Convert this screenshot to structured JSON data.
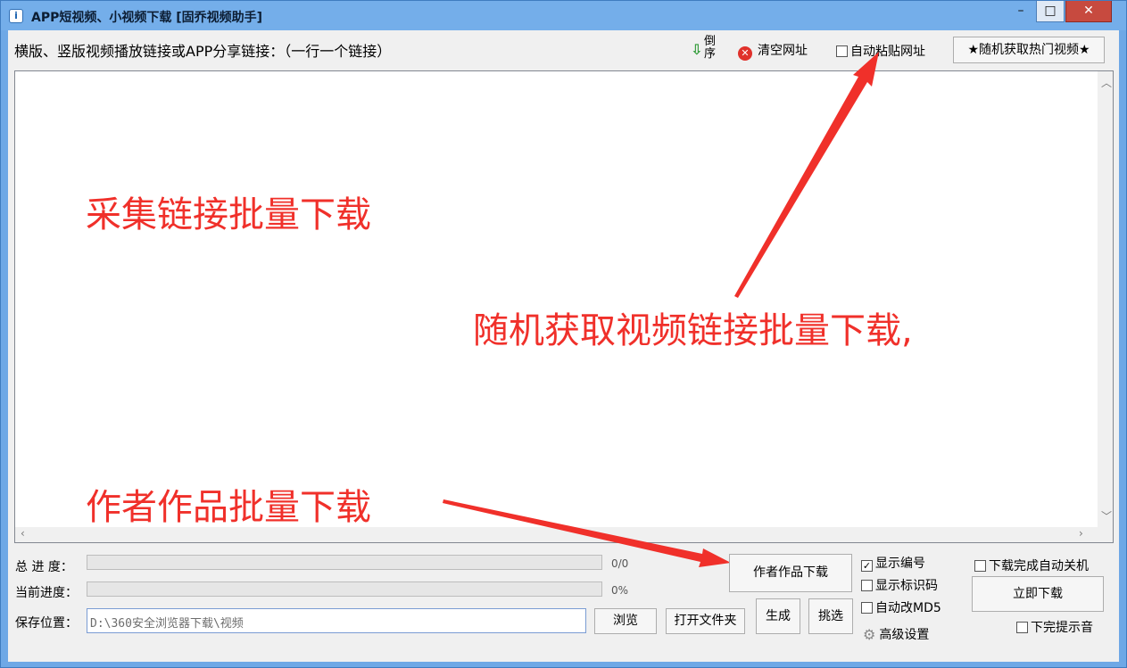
{
  "window": {
    "title": "APP短视频、小视频下载 [固乔视频助手]",
    "min_glyph": "–",
    "max_glyph": "□",
    "close_glyph": "✕"
  },
  "toolbar": {
    "link_label": "横版、竖版视频播放链接或APP分享链接：（一行一个链接）",
    "sort_label": "倒序",
    "clear_label": "清空网址",
    "auto_paste_label": "自动粘贴网址",
    "auto_paste_checked": false,
    "random_hot_label": "★随机获取热门视频★"
  },
  "url_input": {
    "value": ""
  },
  "annotations": {
    "batch_collect": "采集链接批量下载",
    "random_fetch": "随机获取视频链接批量下载,",
    "author_batch": "作者作品批量下载",
    "color": "#f0302a"
  },
  "progress": {
    "total_label": "总 进 度：",
    "total_value": "0/0",
    "total_fraction": 0,
    "current_label": "当前进度：",
    "current_value": "0%",
    "current_fraction": 0
  },
  "save": {
    "label": "保存位置：",
    "path": "D:\\360安全浏览器下载\\视频",
    "browse_label": "浏览",
    "open_folder_label": "打开文件夹"
  },
  "actions": {
    "author_download_label": "作者作品下载",
    "generate_label": "生成",
    "pick_label": "挑选",
    "download_now_label": "立即下载"
  },
  "options": {
    "show_number": {
      "label": "显示编号",
      "checked": true
    },
    "show_id_code": {
      "label": "显示标识码",
      "checked": false
    },
    "auto_md5": {
      "label": "自动改MD5",
      "checked": false
    },
    "advanced_label": "高级设置",
    "shutdown_after": {
      "label": "下载完成自动关机",
      "checked": false
    },
    "finish_sound": {
      "label": "下完提示音",
      "checked": false
    }
  }
}
